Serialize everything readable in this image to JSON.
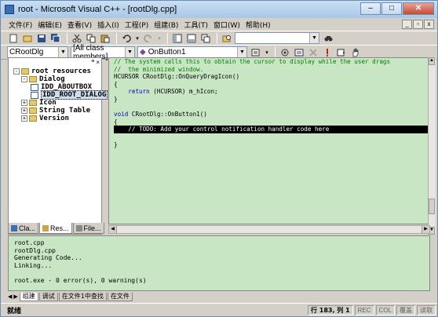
{
  "window": {
    "title": "root - Microsoft Visual C++ - [rootDlg.cpp]",
    "min": "–",
    "max": "□",
    "close": "✕"
  },
  "menu": [
    "文件(F)",
    "编辑(E)",
    "查看(V)",
    "插入(I)",
    "工程(P)",
    "组建(B)",
    "工具(T)",
    "窗口(W)",
    "帮助(H)"
  ],
  "mdi": {
    "min": "_",
    "restore": "▫",
    "close": "x"
  },
  "toolbar2": {
    "class_combo": "CRootDlg",
    "members_combo": "[All class members]",
    "function_combo": "OnButton1"
  },
  "tree": {
    "root": "root resources",
    "dialog": "Dialog",
    "items": [
      "IDD_ABOUTBOX",
      "IDD_ROOT_DIALOG"
    ],
    "others": [
      "Icon",
      "String Table",
      "Version"
    ]
  },
  "left_tabs": [
    "Cla...",
    "Res...",
    "File..."
  ],
  "code": {
    "l1": "// The system calls this to obtain the cursor to display while the user drags",
    "l2": "//  the minimized window.",
    "l3": "HCURSOR CRootDlg::OnQueryDragIcon()",
    "l4": "{",
    "l5_kw": "return",
    "l5_rest": " (HCURSOR) m_hIcon;",
    "l6": "}",
    "l7": "",
    "l8_kw": "void",
    "l8_rest": " CRootDlg::OnButton1()",
    "l9": "{",
    "l10": "    // TODO: Add your control notification handler code here",
    "l11": "",
    "l12": "}"
  },
  "output": {
    "l1": "root.cpp",
    "l2": "rootDlg.cpp",
    "l3": "Generating Code...",
    "l4": "Linking...",
    "l5": "",
    "l6": "root.exe - 0 error(s), 0 warning(s)"
  },
  "output_tabs": [
    "组建",
    "调试",
    "在文件1中查找",
    "在文件"
  ],
  "status": {
    "left": "就绪",
    "pos": "行 183, 列 1",
    "rec": "REC",
    "col": "COL",
    "ovr": "覆盖",
    "read": "读取"
  }
}
